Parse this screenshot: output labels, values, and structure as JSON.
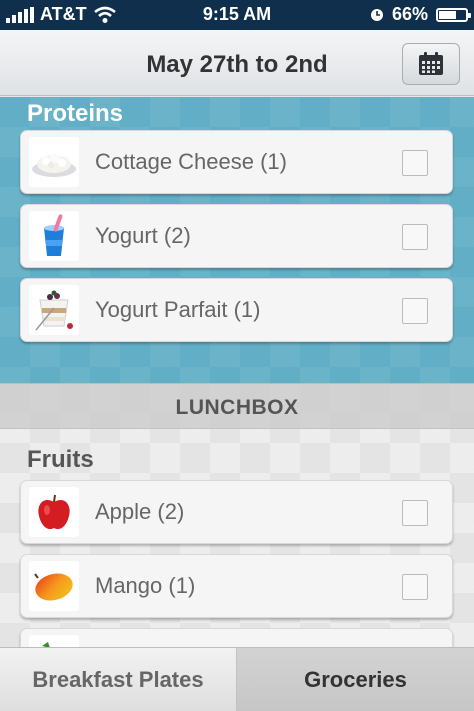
{
  "status_bar": {
    "carrier": "AT&T",
    "time": "9:15 AM",
    "battery": "66%",
    "battery_level": 0.66
  },
  "nav": {
    "title": "May 27th to 2nd",
    "calendar_icon": "calendar-icon"
  },
  "proteins": {
    "heading": "Proteins",
    "items": [
      {
        "label": "Cottage Cheese (1)",
        "icon": "cottage-cheese-icon",
        "checked": false
      },
      {
        "label": "Yogurt (2)",
        "icon": "yogurt-icon",
        "checked": false
      },
      {
        "label": "Yogurt Parfait (1)",
        "icon": "yogurt-parfait-icon",
        "checked": false
      }
    ]
  },
  "lunchbox": {
    "header": "LUNCHBOX",
    "fruits": {
      "heading": "Fruits",
      "items": [
        {
          "label": "Apple (2)",
          "icon": "apple-icon",
          "checked": false
        },
        {
          "label": "Mango (1)",
          "icon": "mango-icon",
          "checked": false
        },
        {
          "label": "",
          "icon": "raspberry-icon",
          "checked": false
        }
      ]
    }
  },
  "tabs": [
    {
      "label": "Breakfast Plates",
      "selected": false
    },
    {
      "label": "Groceries",
      "selected": true
    }
  ],
  "colors": {
    "status_bar": "#0f2f4c",
    "proteins_background": "#62aec6",
    "lunchbox_background": "#e4e4e4"
  }
}
